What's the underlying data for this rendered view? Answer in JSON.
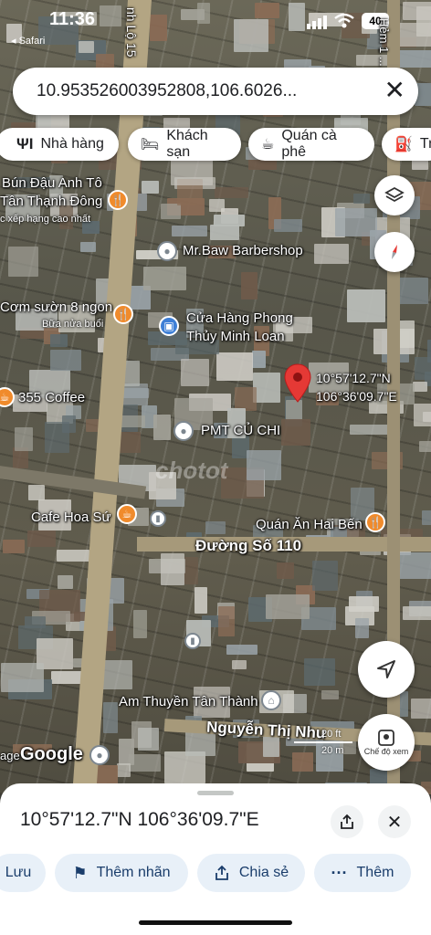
{
  "status": {
    "time": "11:36",
    "back_app": "Safari",
    "battery": "40"
  },
  "search": {
    "value": "10.953526003952808,106.6026...",
    "clear_label": "×"
  },
  "chips": [
    {
      "label": "Nhà hàng"
    },
    {
      "label": "Khách sạn"
    },
    {
      "label": "Quán cà phê"
    },
    {
      "label": "Tr"
    }
  ],
  "map": {
    "road_labels": {
      "tinh_lo": "nh Lộ 15",
      "duong_so_110": "Đường Số 110",
      "nguyen_thi_nhu": "Nguyễn Thị Nhu",
      "right_road": "Hẻm 1 ... g Số 1"
    },
    "places": {
      "bun_dau": "Bún Đậu Anh Tô",
      "bun_dau_sub": "Tân Thạnh Đông",
      "bun_dau_note": "c xếp hạng cao nhất",
      "barber": "Mr.Baw Barbershop",
      "com_suon": "Cơm sườn 8 ngon",
      "com_suon_sub": "Bữa nửa buổi",
      "cua_hang_1": "Cửa Hàng Phong",
      "cua_hang_2": "Thủy Minh Loan",
      "coffee355": "355 Coffee",
      "pmt": "PMT CỦ CHI",
      "cafe_hoa_su": "Cafe Hoa Sứ",
      "quan_an": "Quán Ăn Hai Bến",
      "am_thuyen": "Am Thuyền Tân Thành",
      "age": "age"
    },
    "pin_coords": {
      "lat": "10°57'12.7\"N",
      "lon": "106°36'09.7\"E"
    },
    "watermark": "chotot",
    "google": "Google",
    "scale": {
      "ft": "20 ft",
      "m": "20 m"
    },
    "view_mode_label": "Chế độ xem"
  },
  "sheet": {
    "coords": "10°57'12.7\"N 106°36'09.7\"E",
    "actions": [
      {
        "label": "Lưu"
      },
      {
        "label": "Thêm nhãn"
      },
      {
        "label": "Chia sẻ"
      },
      {
        "label": "Thêm"
      }
    ]
  },
  "colors": {
    "pin": "#e53935",
    "chip_text": "#202124",
    "action_bg": "#e8f0f8",
    "action_text": "#1a3d6b"
  }
}
